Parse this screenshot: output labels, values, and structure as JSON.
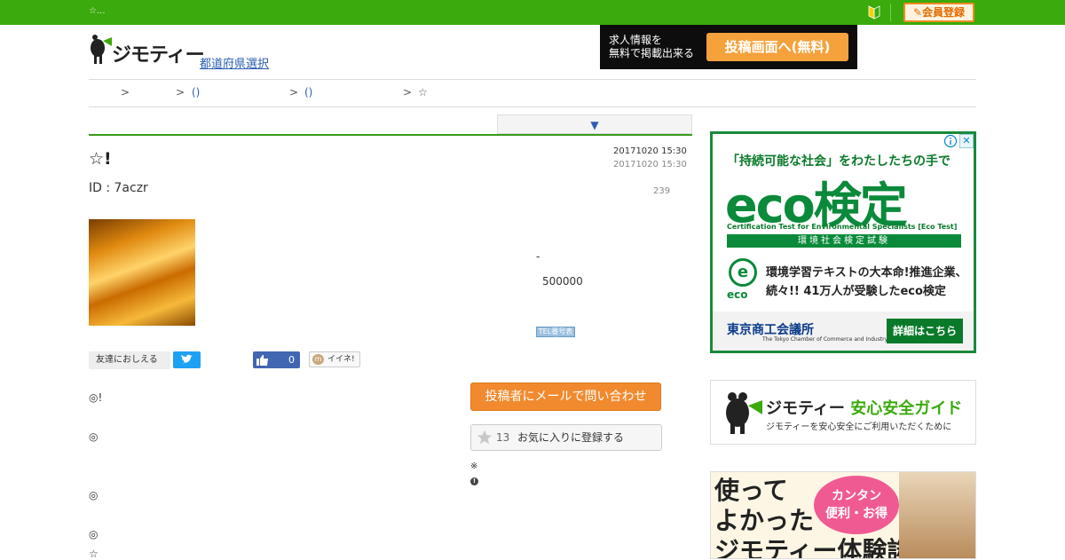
{
  "topbar": {
    "crumb": "☆...",
    "member_label": "✎会員登録"
  },
  "header": {
    "logo_text": "ジモティー",
    "pref_link": "都道府県選択",
    "job_banner": {
      "line1": "求人情報を",
      "line2": "無料で掲載出来る",
      "button": "投稿画面へ(無料)"
    }
  },
  "breadcrumb": {
    "items": [
      ">",
      ">",
      "()",
      ">",
      "()",
      ">",
      "☆"
    ]
  },
  "tab": {
    "arrow": "▼"
  },
  "post": {
    "title": "☆!",
    "posted": "20171020 15:30",
    "updated": "20171020 15:30",
    "views": "239",
    "id_label": "ID : 7aczr",
    "dash": "-",
    "price": "500000",
    "tel_badge": "TEL番号表示"
  },
  "share": {
    "tell_friends": "友達におしえる",
    "fb_count": "0",
    "iine": "イイネ!",
    "iine_mark": "m"
  },
  "body": {
    "lines": [
      "◎!",
      "◎",
      "◎",
      "◎",
      "☆"
    ]
  },
  "actions": {
    "mail_button": "投稿者にメールで問い合わせ",
    "fav_count": "13",
    "fav_label": "お気に入りに登録する",
    "note1": "※",
    "note2": "!"
  },
  "ad_eco": {
    "catch": "「持続可能な社会」をわたしたちの手で",
    "big": "eco検定",
    "cert": "Certification Test for Environmental Specialists [Eco Test]",
    "bar": "環境社会検定試験",
    "logo_letter": "e",
    "logo_text": "eco",
    "desc1": "環境学習テキストの大本命!推進企業、",
    "desc2": "続々!! 41万人が受験したeco検定",
    "jcci": "東京商工会議所",
    "jcci_sub": "The Tokyo Chamber of Commerce and Industry",
    "detail_button": "詳細はこちら",
    "close": "✕"
  },
  "guide": {
    "brand": "ジモティー",
    "title": "安心安全ガイド",
    "sub": "ジモティーを安心安全にご利用いただくために"
  },
  "ad_taiken": {
    "line1": "使って",
    "line2": "よかった",
    "line3": "ジモティー体験談",
    "bubble1": "カンタン",
    "bubble2": "便利・お得"
  },
  "colors": {
    "brand_green": "#3aaa0c",
    "accent_orange": "#f18a2e",
    "link_blue": "#2a5db0"
  }
}
